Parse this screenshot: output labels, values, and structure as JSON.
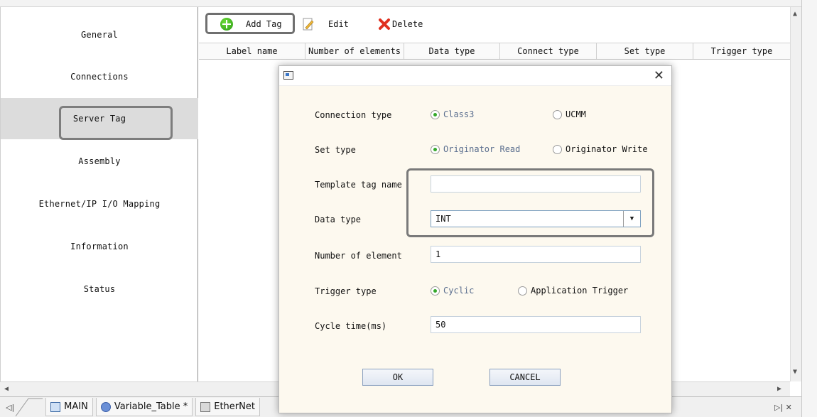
{
  "toolbar": {
    "add_tag": "Add Tag",
    "edit": "Edit",
    "delete": "Delete"
  },
  "sidebar": {
    "items": [
      {
        "label": "General"
      },
      {
        "label": "Connections"
      },
      {
        "label": "Server Tag",
        "selected": true
      },
      {
        "label": "Assembly"
      },
      {
        "label": "Ethernet/IP I/O Mapping"
      },
      {
        "label": "Information"
      },
      {
        "label": "Status"
      }
    ]
  },
  "table": {
    "columns": [
      "Label name",
      "Number of elements",
      "Data type",
      "Connect type",
      "Set type",
      "Trigger type"
    ]
  },
  "tabs": [
    {
      "label": "MAIN",
      "icon": "program-icon"
    },
    {
      "label": "Variable_Table *",
      "icon": "gear-icon"
    },
    {
      "label": "EtherNet",
      "icon": "ethernet-icon"
    }
  ],
  "dialog": {
    "connection_type": {
      "label": "Connection type",
      "options": [
        "Class3",
        "UCMM"
      ],
      "selected": "Class3"
    },
    "set_type": {
      "label": "Set type",
      "options": [
        "Originator Read",
        "Originator Write"
      ],
      "selected": "Originator Read"
    },
    "template_tag_name": {
      "label": "Template tag name",
      "value": ""
    },
    "data_type": {
      "label": "Data type",
      "value": "INT"
    },
    "number_of_element": {
      "label": "Number of element",
      "value": "1"
    },
    "trigger_type": {
      "label": "Trigger type",
      "options": [
        "Cyclic",
        "Application Trigger"
      ],
      "selected": "Cyclic"
    },
    "cycle_time": {
      "label": "Cycle time(ms)",
      "value": "50"
    },
    "ok": "OK",
    "cancel": "CANCEL"
  },
  "colors": {
    "highlight_border": "#7a7a7a",
    "dialog_bg": "#fdf9ef",
    "radio_selected": "#35a82a"
  }
}
